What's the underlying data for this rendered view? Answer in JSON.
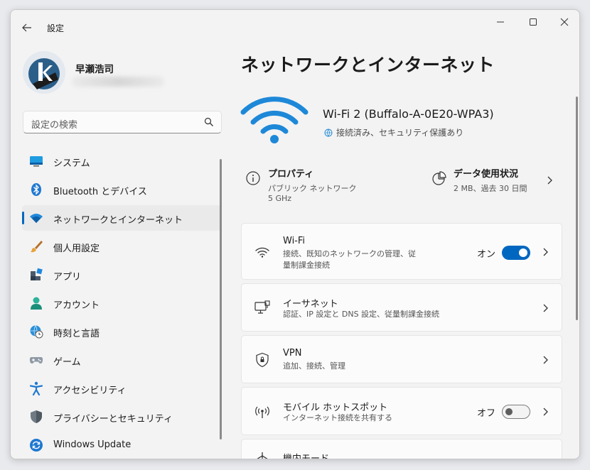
{
  "window": {
    "title": "設定"
  },
  "profile": {
    "name": "早瀬浩司"
  },
  "search": {
    "placeholder": "設定の検索"
  },
  "sidebar": {
    "items": [
      {
        "label": "システム",
        "icon": "monitor-icon"
      },
      {
        "label": "Bluetooth とデバイス",
        "icon": "bluetooth-icon"
      },
      {
        "label": "ネットワークとインターネット",
        "icon": "wifi-icon",
        "selected": true
      },
      {
        "label": "個人用設定",
        "icon": "paintbrush-icon"
      },
      {
        "label": "アプリ",
        "icon": "apps-icon"
      },
      {
        "label": "アカウント",
        "icon": "account-icon"
      },
      {
        "label": "時刻と言語",
        "icon": "globe-clock-icon"
      },
      {
        "label": "ゲーム",
        "icon": "gamepad-icon"
      },
      {
        "label": "アクセシビリティ",
        "icon": "accessibility-icon"
      },
      {
        "label": "プライバシーとセキュリティ",
        "icon": "shield-icon"
      },
      {
        "label": "Windows Update",
        "icon": "update-icon"
      }
    ]
  },
  "main": {
    "title": "ネットワークとインターネット",
    "network": {
      "name": "Wi-Fi 2 (Buffalo-A-0E20-WPA3)",
      "status": "接続済み、セキュリティ保護あり"
    },
    "properties": {
      "title": "プロパティ",
      "line1": "パブリック ネットワーク",
      "line2": "5 GHz"
    },
    "data_usage": {
      "title": "データ使用状況",
      "line1": "2 MB、過去 30 日間"
    },
    "cards": [
      {
        "title": "Wi-Fi",
        "subtitle_line1": "接続、既知のネットワークの管理、従",
        "subtitle_line2": "量制課金接続",
        "state": "オン",
        "toggle": true,
        "icon": "wifi-icon"
      },
      {
        "title": "イーサネット",
        "subtitle_line1": "認証、IP 設定と DNS 設定、従量制課金接続",
        "icon": "ethernet-icon"
      },
      {
        "title": "VPN",
        "subtitle_line1": "追加、接続、管理",
        "icon": "vpn-shield-icon"
      },
      {
        "title": "モバイル ホットスポット",
        "subtitle_line1": "インターネット接続を共有する",
        "state": "オフ",
        "toggle": false,
        "icon": "hotspot-icon"
      },
      {
        "title": "機内モード",
        "icon": "airplane-icon"
      }
    ]
  },
  "colors": {
    "accent": "#0067c0",
    "wifi_hero": "#1e88d8"
  }
}
